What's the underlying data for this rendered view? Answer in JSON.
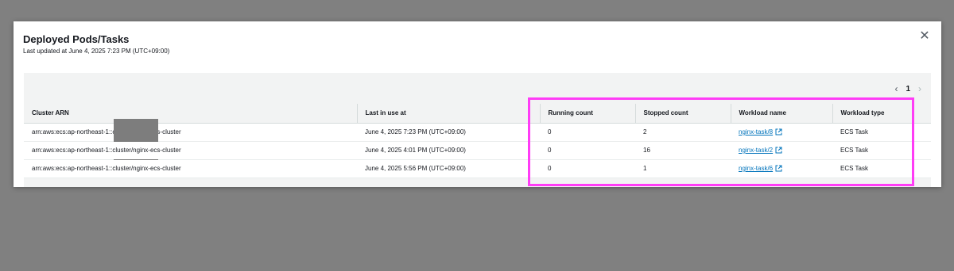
{
  "modal": {
    "title": "Deployed Pods/Tasks",
    "subtitle": "Last updated at June 4, 2025 7:23 PM (UTC+09:00)",
    "close_icon": "close-icon"
  },
  "pagination": {
    "current_page": "1",
    "prev_icon": "chevron-left-icon",
    "next_icon": "chevron-right-icon"
  },
  "table": {
    "columns": [
      "Cluster ARN",
      "Last in use at",
      "Running count",
      "Stopped count",
      "Workload name",
      "Workload type"
    ],
    "rows": [
      {
        "arn_prefix": "arn:aws:ecs:ap-northeast-1:",
        "arn_suffix": ":cluster/nginx-ecs-cluster",
        "last_in_use": "June 4, 2025 7:23 PM (UTC+09:00)",
        "running": "0",
        "stopped": "2",
        "workload_name": "nginx-task/8",
        "workload_type": "ECS Task"
      },
      {
        "arn_prefix": "arn:aws:ecs:ap-northeast-1:",
        "arn_suffix": ":cluster/nginx-ecs-cluster",
        "last_in_use": "June 4, 2025 4:01 PM (UTC+09:00)",
        "running": "0",
        "stopped": "16",
        "workload_name": "nginx-task/2",
        "workload_type": "ECS Task"
      },
      {
        "arn_prefix": "arn:aws:ecs:ap-northeast-1:",
        "arn_suffix": ":cluster/nginx-ecs-cluster",
        "last_in_use": "June 4, 2025 5:56 PM (UTC+09:00)",
        "running": "0",
        "stopped": "1",
        "workload_name": "nginx-task/6",
        "workload_type": "ECS Task"
      }
    ]
  },
  "colors": {
    "highlight": "#ff3cf6",
    "link": "#0073bb",
    "redaction": "#7d7d7d"
  }
}
